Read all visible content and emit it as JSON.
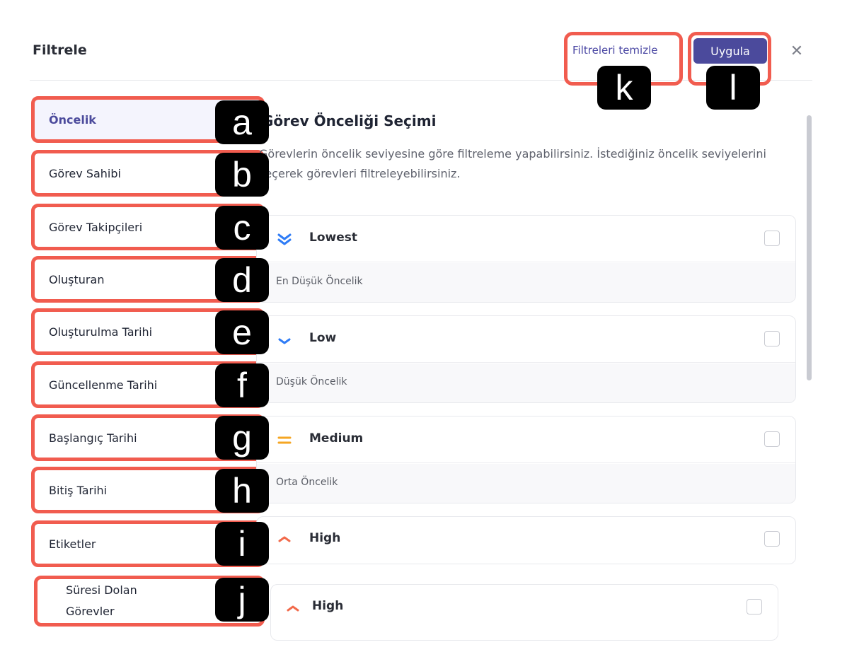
{
  "header": {
    "title": "Filtrele",
    "clear_label": "Filtreleri temizle",
    "apply_label": "Uygula",
    "close_glyph": "✕"
  },
  "sidebar": {
    "items": [
      {
        "label": "Öncelik",
        "badge": "a"
      },
      {
        "label": "Görev Sahibi",
        "badge": "b"
      },
      {
        "label": "Görev Takipçileri",
        "badge": "c"
      },
      {
        "label": "Oluşturan",
        "badge": "d"
      },
      {
        "label": "Oluşturulma Tarihi",
        "badge": "e"
      },
      {
        "label": "Güncellenme Tarihi",
        "badge": "f"
      },
      {
        "label": "Başlangıç Tarihi",
        "badge": "g"
      },
      {
        "label": "Bitiş Tarihi",
        "badge": "h"
      },
      {
        "label": "Etiketler",
        "badge": "i"
      },
      {
        "label": "Süresi Dolan Görevler",
        "badge": "j"
      }
    ]
  },
  "header_badges": {
    "clear": "k",
    "apply": "l"
  },
  "content": {
    "title": "Görev Önceliği Seçimi",
    "description": "Görevlerin öncelik seviyesine göre filtreleme yapabilirsiniz. İstediğiniz öncelik seviyelerini seçerek görevleri filtreleyebilirsiniz.",
    "options": [
      {
        "name": "Lowest",
        "sub": "En Düşük Öncelik",
        "icon": "double-chevron-down-icon",
        "color": "#2f7cf6"
      },
      {
        "name": "Low",
        "sub": "Düşük Öncelik",
        "icon": "chevron-down-icon",
        "color": "#2f7cf6"
      },
      {
        "name": "Medium",
        "sub": "Orta Öncelik",
        "icon": "equals-icon",
        "color": "#f5a623"
      },
      {
        "name": "High",
        "sub": "",
        "icon": "chevron-up-icon",
        "color": "#f26a4b"
      },
      {
        "name": "High",
        "sub": "",
        "icon": "chevron-up-icon",
        "color": "#f26a4b"
      }
    ]
  },
  "colors": {
    "accent": "#4b4a9c",
    "highlight": "#f15c4f"
  }
}
